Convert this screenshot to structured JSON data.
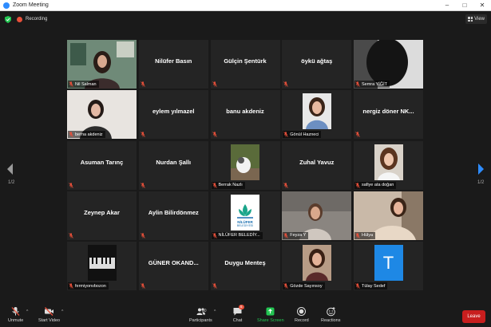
{
  "window": {
    "title": "Zoom Meeting",
    "minimize": "–",
    "maximize": "□",
    "close": "✕"
  },
  "topbar": {
    "recording_label": "Recording",
    "view_label": "View"
  },
  "pager": {
    "left": "1/2",
    "right": "1/2"
  },
  "participants": [
    {
      "label": "Nil Salman",
      "big": "",
      "kind": "video-woman"
    },
    {
      "label": "",
      "big": "Nilüfer Basın",
      "kind": "name"
    },
    {
      "label": "",
      "big": "Gülçin Şentürk",
      "kind": "name"
    },
    {
      "label": "",
      "big": "öykü ağtaş",
      "kind": "name"
    },
    {
      "label": "Semra YİĞİT",
      "big": "",
      "kind": "video-dark"
    },
    {
      "label": "berna akdeniz",
      "big": "",
      "kind": "video-room"
    },
    {
      "label": "",
      "big": "eylem yılmazel",
      "kind": "name"
    },
    {
      "label": "",
      "big": "banu akdeniz",
      "kind": "name"
    },
    {
      "label": "Gönül Hazneci",
      "big": "",
      "kind": "photo-woman"
    },
    {
      "label": "",
      "big": "nergiz döner NK...",
      "kind": "name"
    },
    {
      "label": "",
      "big": "Asuman Tarınç",
      "kind": "name"
    },
    {
      "label": "",
      "big": "Nurdan Şallı",
      "kind": "name"
    },
    {
      "label": "Berrak Nazlı",
      "big": "",
      "kind": "photo-cat"
    },
    {
      "label": "",
      "big": "Zuhal Yavuz",
      "kind": "name"
    },
    {
      "label": "safiye ata doğan",
      "big": "",
      "kind": "photo-woman2"
    },
    {
      "label": "",
      "big": "Zeynep Akar",
      "kind": "name"
    },
    {
      "label": "",
      "big": "Aylin Bilirdönmez",
      "kind": "name"
    },
    {
      "label": "NİLÜFER BELEDİY...",
      "big": "",
      "kind": "logo",
      "logo_line1": "NİLÜFER",
      "logo_line2": "BELEDİYESİ"
    },
    {
      "label": "Feyza Y",
      "big": "",
      "kind": "video-room2"
    },
    {
      "label": "Hülya",
      "big": "",
      "kind": "video-woman2"
    },
    {
      "label": "fermiyonvbozon",
      "big": "",
      "kind": "photo-piano"
    },
    {
      "label": "",
      "big": "GÜNER OKAND...",
      "kind": "name"
    },
    {
      "label": "",
      "big": "Duygu Menteş",
      "kind": "name"
    },
    {
      "label": "Gözde Sayınsoy",
      "big": "",
      "kind": "photo-woman3"
    },
    {
      "label": "Tülay Sedef",
      "big": "",
      "kind": "avatar-letter",
      "letter": "T",
      "color": "#1e88e5"
    }
  ],
  "toolbar": {
    "unmute": "Unmute",
    "start_video": "Start Video",
    "participants": "Participants",
    "participants_count": "50",
    "chat": "Chat",
    "chat_badge": "5",
    "share_screen": "Share Screen",
    "record": "Record",
    "reactions": "Reactions",
    "leave": "Leave"
  },
  "colors": {
    "accent_green": "#23c552",
    "active_speaker": "#c8e63c",
    "leave_red": "#c81e1e",
    "nav_blue": "#2d8cff"
  }
}
